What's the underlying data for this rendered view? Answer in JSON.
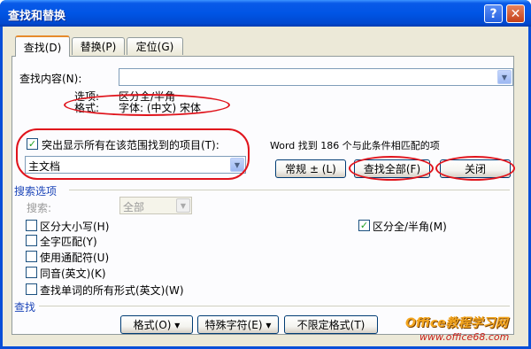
{
  "window": {
    "title": "查找和替换",
    "help_glyph": "?",
    "close_glyph": "✕"
  },
  "tabs": [
    {
      "label": "查找(D)",
      "active": true
    },
    {
      "label": "替换(P)",
      "active": false
    },
    {
      "label": "定位(G)",
      "active": false
    }
  ],
  "find": {
    "label": "查找内容(N):",
    "value": "",
    "options_label": "选项:",
    "options_value": "区分全/半角",
    "format_label": "格式:",
    "format_value": "字体: (中文) 宋体"
  },
  "highlight": {
    "checkbox_label": "突出显示所有在该范围找到的项目(T):",
    "checked": true,
    "scope_value": "主文档"
  },
  "result_text": "Word 找到 186 个与此条件相匹配的项",
  "buttons": {
    "less": "常规 ± (L)",
    "find_all": "查找全部(F)",
    "close": "关闭"
  },
  "search_options": {
    "heading": "搜索选项",
    "search_label": "搜索:",
    "search_value": "全部",
    "checkboxes": [
      {
        "label": "区分大小写(H)",
        "checked": false
      },
      {
        "label": "全字匹配(Y)",
        "checked": false
      },
      {
        "label": "使用通配符(U)",
        "checked": false
      },
      {
        "label": "同音(英文)(K)",
        "checked": false
      },
      {
        "label": "查找单词的所有形式(英文)(W)",
        "checked": false
      }
    ],
    "width_checkbox": {
      "label": "区分全/半角(M)",
      "checked": true
    }
  },
  "find_section": {
    "heading": "查找",
    "format_button": "格式(O) ▾",
    "special_button": "特殊字符(E) ▾",
    "no_format_button": "不限定格式(T)"
  },
  "watermark": {
    "line1": "Office教程学习网",
    "line2": "www.office68.com"
  },
  "colors": {
    "title_bar": "#0055e5",
    "dialog_bg": "#ece9d8",
    "highlight_ring": "#e0141c",
    "section_heading": "#1c45b8"
  }
}
